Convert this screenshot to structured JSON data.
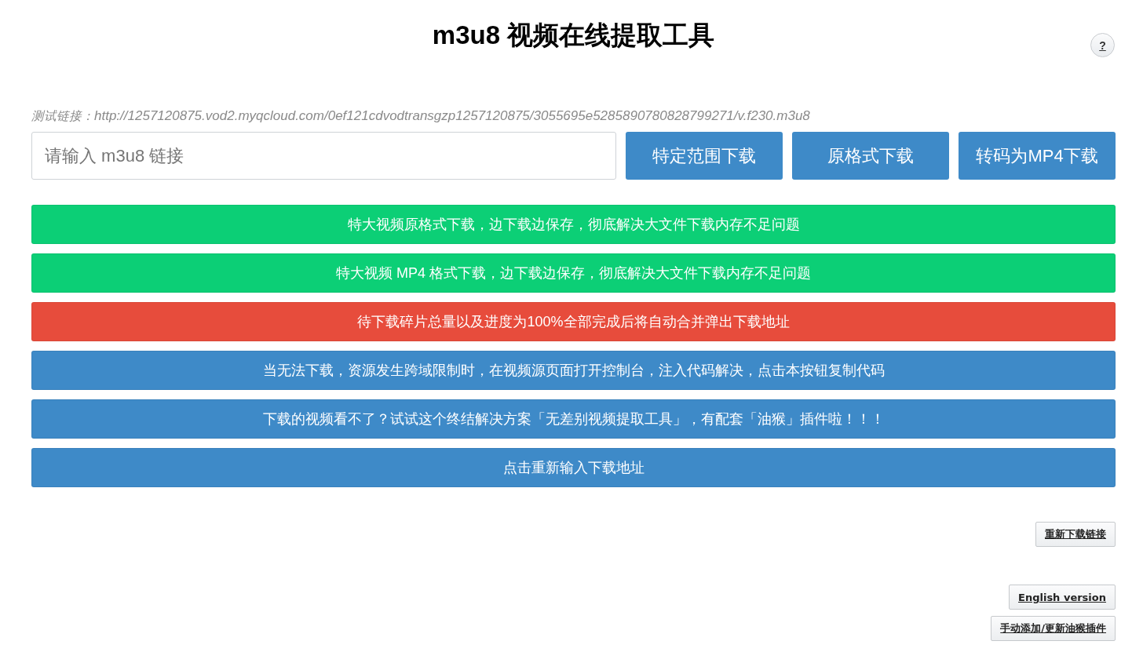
{
  "title": "m3u8 视频在线提取工具",
  "help_button": {
    "label": "?"
  },
  "test_link": {
    "label": "测试链接：",
    "url": "http://1257120875.vod2.myqcloud.com/0ef121cdvodtransgzp1257120875/3055695e5285890780828799271/v.f230.m3u8"
  },
  "url_input": {
    "placeholder": "请输入 m3u8 链接"
  },
  "action_buttons": [
    "特定范围下载",
    "原格式下载",
    "转码为MP4下载"
  ],
  "notice_buttons": [
    {
      "label": "特大视频原格式下载，边下载边保存，彻底解决大文件下载内存不足问题",
      "color": "#0ccf76"
    },
    {
      "label": "特大视频 MP4 格式下载，边下载边保存，彻底解决大文件下载内存不足问题",
      "color": "#0ccf76"
    },
    {
      "label": "待下载碎片总量以及进度为100%全部完成后将自动合并弹出下载地址",
      "color": "#e74c3c"
    },
    {
      "label": "当无法下载，资源发生跨域限制时，在视频源页面打开控制台，注入代码解决，点击本按钮复制代码",
      "color": "#3e8ac8"
    },
    {
      "label": "下载的视频看不了？试试这个终结解决方案「无差别视频提取工具」，有配套「油猴」插件啦！！！",
      "color": "#3e8ac8"
    },
    {
      "label": "点击重新输入下载地址",
      "color": "#3e8ac8"
    }
  ],
  "redownload_button": {
    "label": "重新下载链接"
  },
  "footer_buttons": [
    "English version",
    "手动添加/更新油猴插件"
  ]
}
